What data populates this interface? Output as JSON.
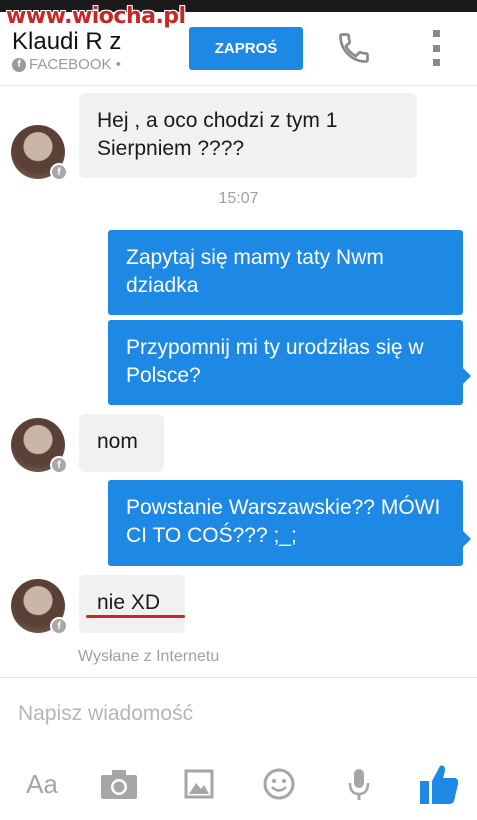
{
  "watermark": "www.wiocha.pl",
  "header": {
    "contact_name": "Klaudi   R  z",
    "source": "FACEBOOK •",
    "invite_label": "ZAPROŚ"
  },
  "messages": [
    {
      "text": "Hej  , a oco chodzi z tym 1 Sierpniem ????"
    },
    {
      "text": "Zapytaj się mamy taty Nwm dziadka"
    },
    {
      "text": "Przypomnij mi ty urodziłas się w Polsce?"
    },
    {
      "text": "nom"
    },
    {
      "text": "Powstanie Warszawskie?? MÓWI CI TO COŚ???  ;_;"
    },
    {
      "text": "nie XD"
    }
  ],
  "timestamp": "15:07",
  "sent_note": "Wysłane z Internetu",
  "composer": {
    "placeholder": "Napisz wiadomość",
    "aa_label": "Aa"
  },
  "colors": {
    "accent": "#1e88e5",
    "incoming": "#f1f1f1",
    "highlight": "#c62828"
  },
  "icons": [
    "call-icon",
    "more-vertical-icon",
    "camera-icon",
    "image-icon",
    "emoji-icon",
    "microphone-icon",
    "thumbs-up-icon"
  ]
}
